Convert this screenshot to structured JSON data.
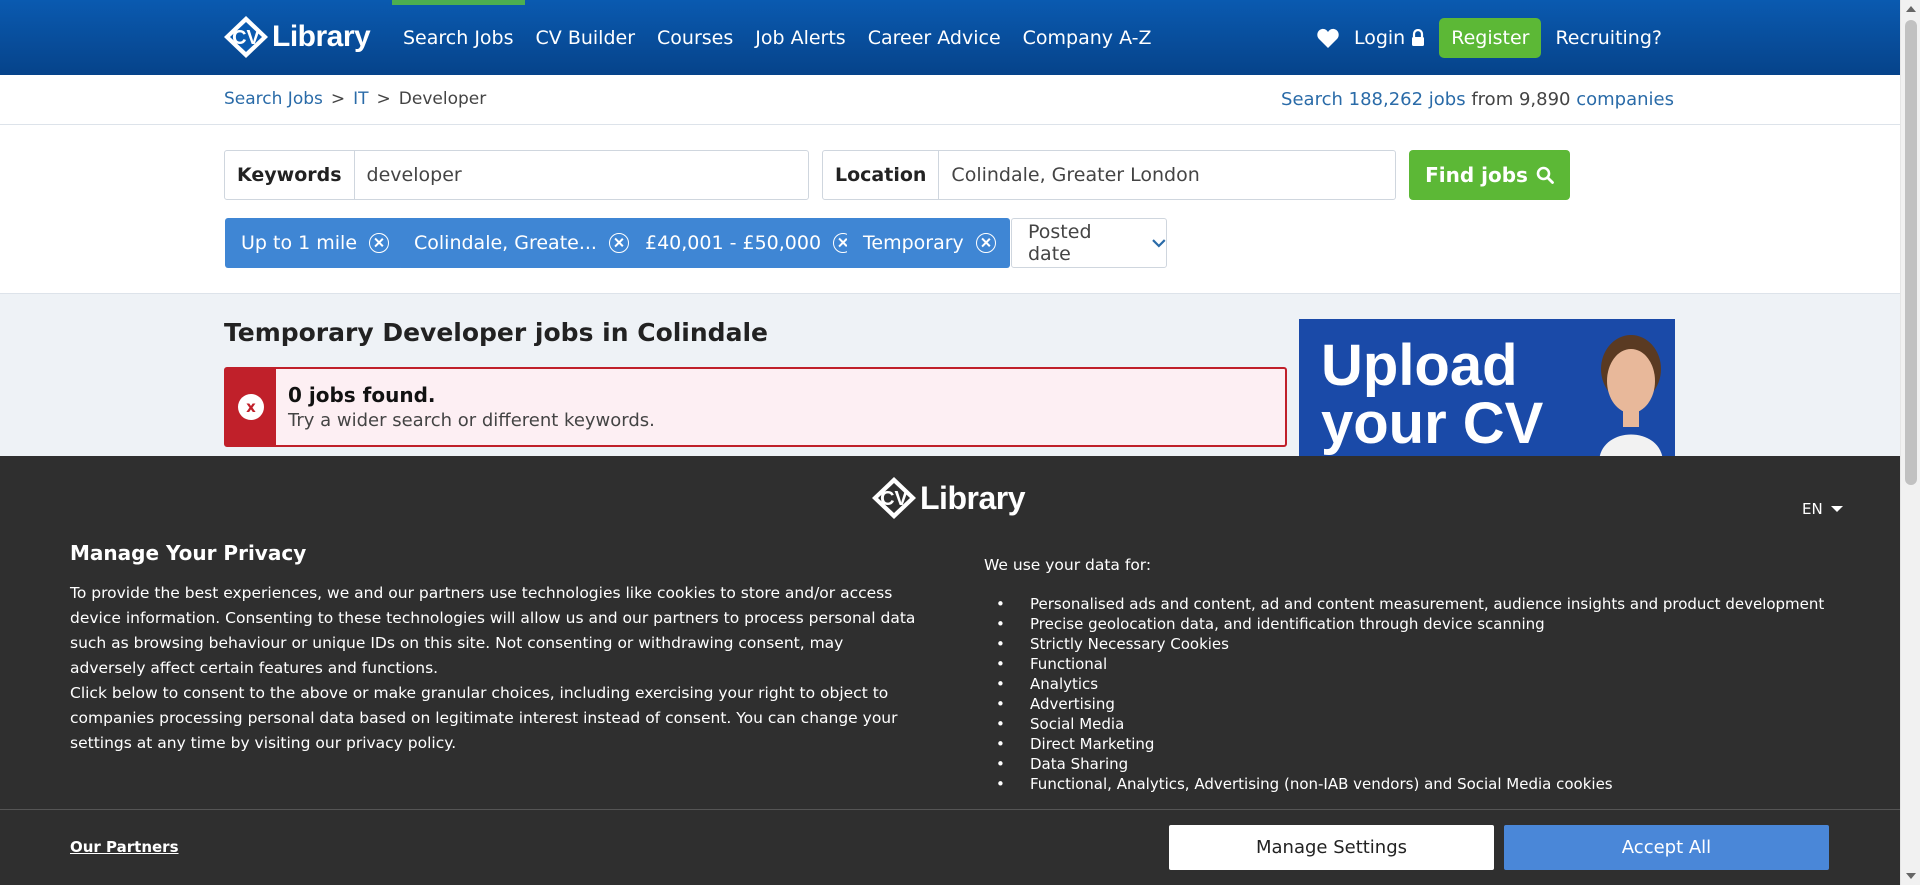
{
  "header": {
    "logo_text": "Library",
    "nav": [
      "Search Jobs",
      "CV Builder",
      "Courses",
      "Job Alerts",
      "Career Advice",
      "Company A-Z"
    ],
    "login": "Login",
    "register": "Register",
    "recruiting": "Recruiting?"
  },
  "breadcrumb": [
    "Search Jobs",
    "IT",
    "Developer"
  ],
  "stats": {
    "prefix": "Search",
    "jobs": "188,262 jobs",
    "middle": "from",
    "count": "9,890",
    "companies": "companies"
  },
  "search": {
    "keywords_label": "Keywords",
    "keywords_value": "developer",
    "location_label": "Location",
    "location_value": "Colindale, Greater London",
    "find_button": "Find jobs"
  },
  "filters": [
    "Up to 1 mile",
    "Colindale, Greate...",
    "£40,001 - £50,000",
    "Temporary"
  ],
  "posted_date": "Posted date",
  "results": {
    "title": "Temporary Developer jobs in Colindale",
    "alert_title": "0 jobs found.",
    "alert_text": "Try a wider search or different keywords."
  },
  "ad": {
    "line1": "Upload",
    "line2": "your CV"
  },
  "privacy": {
    "logo_text": "Library",
    "lang": "EN",
    "title": "Manage Your Privacy",
    "para1": "To provide the best experiences, we and our partners use technologies like cookies to store and/or access device information. Consenting to these technologies will allow us and our partners to process personal data such as browsing behaviour or unique IDs on this site. Not consenting or withdrawing consent, may adversely affect certain features and functions.",
    "para2": "Click below to consent to the above or make granular choices, including exercising your right to object to companies processing personal data based on legitimate interest instead of consent. You can change your settings at any time by visiting our privacy policy.",
    "data_heading": "We use your data for:",
    "uses": [
      "Personalised ads and content, ad and content measurement, audience insights and product development",
      "Precise geolocation data, and identification through device scanning",
      "Strictly Necessary Cookies",
      "Functional",
      "Analytics",
      "Advertising",
      "Social Media",
      "Direct Marketing",
      "Data Sharing",
      "Functional, Analytics, Advertising (non-IAB vendors) and Social Media cookies"
    ],
    "partners": "Our Partners",
    "manage": "Manage Settings",
    "accept": "Accept All"
  },
  "colors": {
    "header_blue": "#06438a",
    "green": "#5cb836",
    "chip_blue": "#3f86d4",
    "alert_red": "#c0202a",
    "overlay": "#2f2f2f",
    "accept_blue": "#4a87d8"
  }
}
